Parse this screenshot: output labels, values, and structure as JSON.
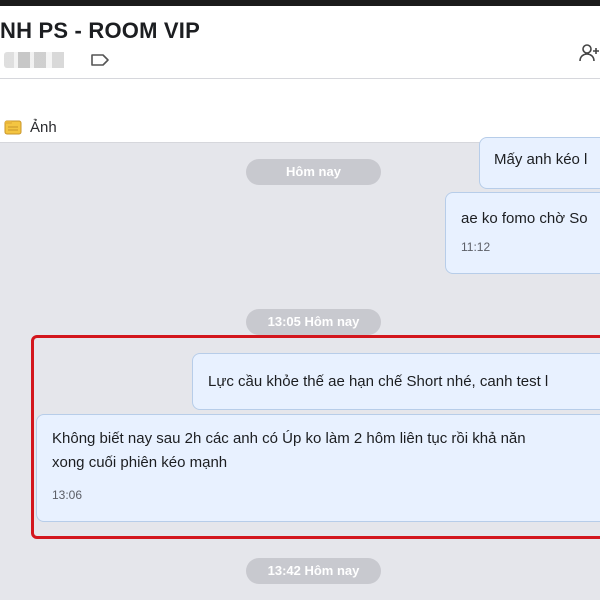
{
  "header": {
    "title": "NH PS - ROOM VIP"
  },
  "tabbar": {
    "tab_label": "Ảnh"
  },
  "messages": {
    "divider_1": "Hôm nay",
    "msg_1_text": "Mấy anh kéo l",
    "msg_2_text": "ae ko fomo chờ So",
    "msg_2_time": "11:12",
    "divider_2": "13:05 Hôm nay",
    "msg_3_text": "Lực cầu khỏe thế ae hạn chế Short nhé, canh test l",
    "msg_4_line1": "Không biết nay sau 2h các anh có Úp ko làm 2 hôm liên tục rồi khả năn",
    "msg_4_line2": "xong cuối phiên kéo mạnh",
    "msg_4_time": "13:06",
    "divider_3": "13:42 Hôm nay"
  },
  "colors": {
    "bubble_bg": "#e8f1ff",
    "highlight_border": "#d3161d",
    "pill_bg": "#c8c9cf",
    "chat_bg": "#e5e6eb"
  },
  "icons": {
    "tag": "tag-icon",
    "header_right": "add-member-icon",
    "tab": "image-folder-icon"
  }
}
